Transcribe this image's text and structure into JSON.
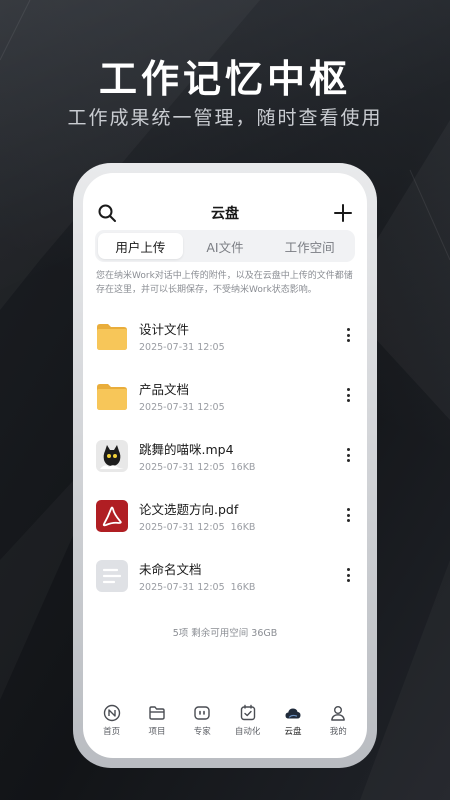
{
  "promo": {
    "headline": "工作记忆中枢",
    "subline": "工作成果统一管理，随时查看使用"
  },
  "app": {
    "title": "云盘",
    "search_icon": "search-icon",
    "add_icon": "plus-icon",
    "tabs": [
      {
        "label": "用户上传",
        "active": true
      },
      {
        "label": "AI文件",
        "active": false
      },
      {
        "label": "工作空间",
        "active": false
      }
    ],
    "notice": "您在纳米Work对话中上传的附件，以及在云盘中上传的文件都储存在这里，并可以长期保存，不受纳米Work状态影响。",
    "files": [
      {
        "name": "设计文件",
        "date": "2025-07-31 12:05",
        "size": "",
        "type": "folder"
      },
      {
        "name": "产品文档",
        "date": "2025-07-31 12:05",
        "size": "",
        "type": "folder"
      },
      {
        "name": "跳舞的喵咪.mp4",
        "date": "2025-07-31 12:05",
        "size": "16KB",
        "type": "video"
      },
      {
        "name": "论文选题方向.pdf",
        "date": "2025-07-31 12:05",
        "size": "16KB",
        "type": "pdf"
      },
      {
        "name": "未命名文档",
        "date": "2025-07-31 12:05",
        "size": "16KB",
        "type": "doc"
      }
    ],
    "summary": {
      "count": "5项",
      "space": "剩余可用空间 36GB"
    },
    "nav": [
      {
        "label": "首页",
        "icon": "home-icon",
        "active": false
      },
      {
        "label": "项目",
        "icon": "folder-icon",
        "active": false
      },
      {
        "label": "专家",
        "icon": "expert-icon",
        "active": false
      },
      {
        "label": "自动化",
        "icon": "automation-icon",
        "active": false
      },
      {
        "label": "云盘",
        "icon": "cloud-icon",
        "active": true
      },
      {
        "label": "我的",
        "icon": "user-icon",
        "active": false
      }
    ]
  },
  "colors": {
    "folder": "#f7c659",
    "pdf": "#b01e23",
    "doc": "#dfe1e5",
    "cloud_active": "#1f2a3a"
  }
}
